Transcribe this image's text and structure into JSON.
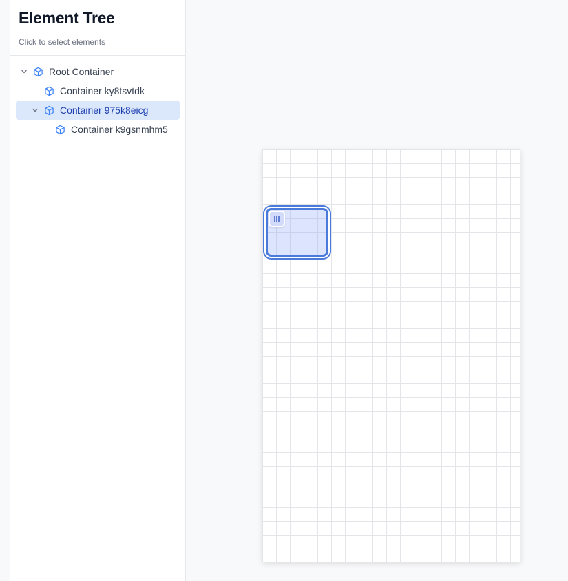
{
  "sidebar": {
    "title": "Element Tree",
    "subtitle": "Click to select elements",
    "items": [
      {
        "label": "Root Container",
        "level": 0,
        "expandable": true,
        "expanded": true,
        "selected": false,
        "icon": "cube-icon"
      },
      {
        "label": "Container ky8tsvtdk",
        "level": 1,
        "expandable": false,
        "expanded": false,
        "selected": false,
        "icon": "cube-icon"
      },
      {
        "label": "Container 975k8eicg",
        "level": 1,
        "expandable": true,
        "expanded": true,
        "selected": true,
        "icon": "cube-icon"
      },
      {
        "label": "Container k9gsnmhm5",
        "level": 2,
        "expandable": false,
        "expanded": false,
        "selected": false,
        "icon": "cube-icon"
      }
    ]
  },
  "canvas": {
    "drag_handle_icon": "grip-dots-icon"
  },
  "colors": {
    "accent": "#4a7bdb",
    "selected_row_bg": "#dbe8fc",
    "selected_text": "#1e40af",
    "icon_blue": "#3b82f6"
  }
}
